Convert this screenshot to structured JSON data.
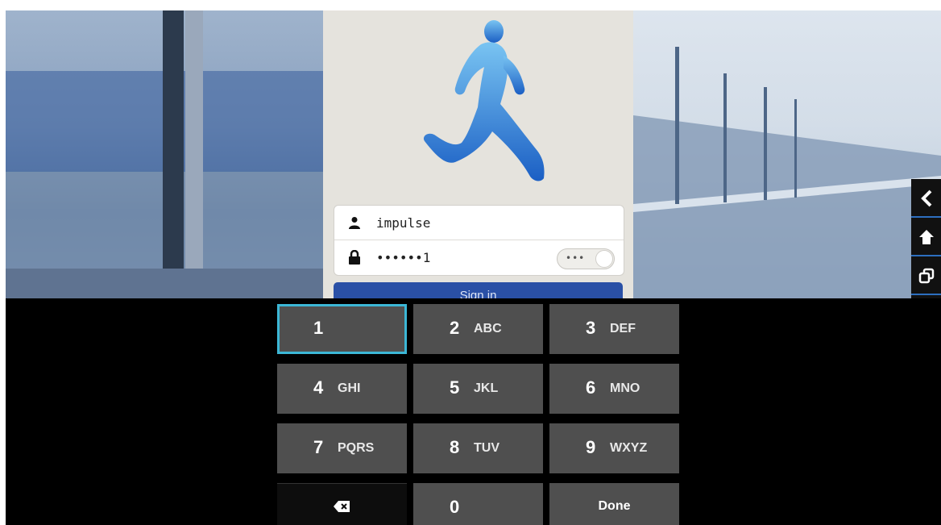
{
  "login": {
    "username": "impulse",
    "password_masked": "••••••1",
    "reveal_dots": "•••",
    "signin_label": "Sign in"
  },
  "side_panel": {
    "icons": [
      "back-icon",
      "home-icon",
      "recent-apps-icon",
      "menu-icon"
    ]
  },
  "keypad": {
    "keys": [
      {
        "digit": "1",
        "letters": ""
      },
      {
        "digit": "2",
        "letters": "ABC"
      },
      {
        "digit": "3",
        "letters": "DEF"
      },
      {
        "digit": "4",
        "letters": "GHI"
      },
      {
        "digit": "5",
        "letters": "JKL"
      },
      {
        "digit": "6",
        "letters": "MNO"
      },
      {
        "digit": "7",
        "letters": "PQRS"
      },
      {
        "digit": "8",
        "letters": "TUV"
      },
      {
        "digit": "9",
        "letters": "WXYZ"
      },
      {
        "digit": "0",
        "letters": ""
      }
    ],
    "done_label": "Done",
    "focused_key": "1"
  },
  "colors": {
    "signin_button": "#2a50a6",
    "focus_ring": "#3cb7d6",
    "key_background": "#4f4f4f",
    "logo_blue": "#2f7fd8"
  }
}
